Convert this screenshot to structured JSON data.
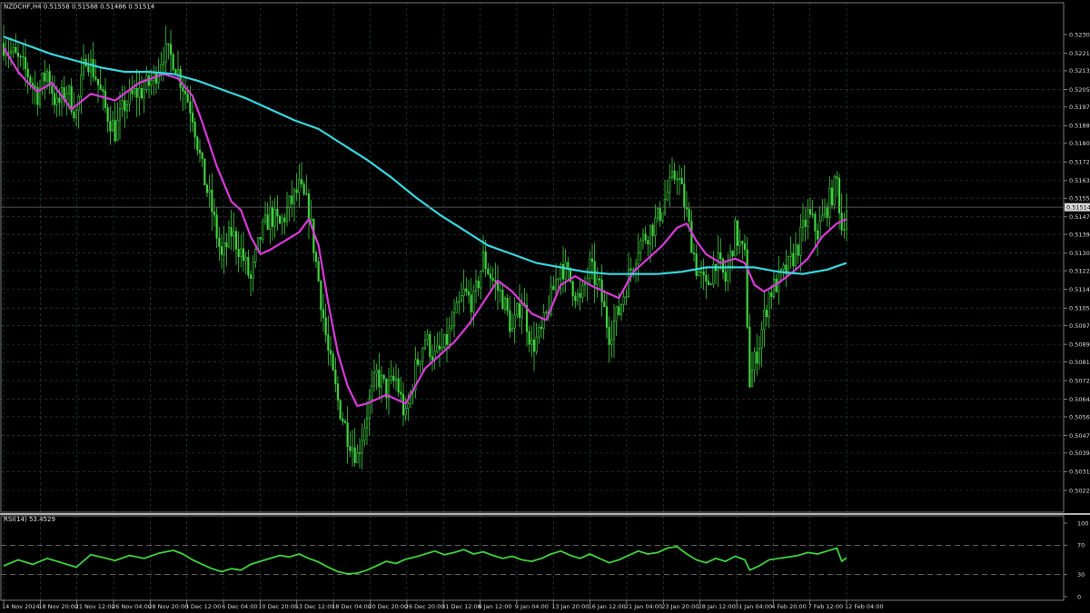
{
  "window": {
    "symbol_header": "NZDCHF,H4  0.51558 0.51588 0.51486 0.51514",
    "current_price_label": "0.51514",
    "indicator_header": "RSI(14) 53.4529"
  },
  "colors": {
    "background": "#000000",
    "grid": "#2f4a4a",
    "candle": "#3fd13f",
    "ma_fast": "#d83ad8",
    "ma_slow": "#38d8e0",
    "rsi_line": "#3fd13f",
    "text": "#d8d8d8"
  },
  "chart_data": [
    {
      "type": "candlestick",
      "title": "",
      "price_ticks": [
        "0.52300",
        "0.52215",
        "0.52135",
        "0.52050",
        "0.51970",
        "0.51885",
        "0.51805",
        "0.51720",
        "0.51635",
        "0.51555",
        "0.51470",
        "0.51390",
        "0.51305",
        "0.51225",
        "0.51140",
        "0.51055",
        "0.50975",
        "0.50890",
        "0.50810",
        "0.50725",
        "0.50640",
        "0.50560",
        "0.50475",
        "0.50395",
        "0.50310",
        "0.50225"
      ],
      "price_ylim": [
        0.50225,
        0.5236
      ],
      "current_price": 0.51514,
      "time_ticks": [
        "14 Nov 2024",
        "18 Nov 20:00",
        "21 Nov 12:00",
        "26 Nov 04:00",
        "28 Nov 20:00",
        "3 Dec 12:00",
        "6 Dec 04:00",
        "10 Dec 20:00",
        "13 Dec 12:00",
        "18 Dec 04:00",
        "20 Dec 20:00",
        "26 Dec 20:00",
        "31 Dec 12:00",
        "6 Jan 12:00",
        "9 Jan 04:00",
        "13 Jan 20:00",
        "16 Jan 12:00",
        "21 Jan 04:00",
        "23 Jan 20:00",
        "28 Jan 12:00",
        "31 Jan 04:00",
        "4 Feb 20:00",
        "7 Feb 12:00",
        "12 Feb 04:00"
      ],
      "grid": true,
      "close_anchors": [
        [
          0,
          0.5226
        ],
        [
          6,
          0.5218
        ],
        [
          10,
          0.5212
        ],
        [
          14,
          0.5203
        ],
        [
          18,
          0.5213
        ],
        [
          22,
          0.5197
        ],
        [
          26,
          0.5205
        ],
        [
          30,
          0.5194
        ],
        [
          34,
          0.5221
        ],
        [
          38,
          0.5211
        ],
        [
          42,
          0.5196
        ],
        [
          46,
          0.5186
        ],
        [
          50,
          0.5198
        ],
        [
          54,
          0.5203
        ],
        [
          58,
          0.5205
        ],
        [
          62,
          0.521
        ],
        [
          66,
          0.5222
        ],
        [
          70,
          0.5219
        ],
        [
          74,
          0.5207
        ],
        [
          78,
          0.5194
        ],
        [
          82,
          0.5168
        ],
        [
          86,
          0.515
        ],
        [
          90,
          0.5128
        ],
        [
          94,
          0.514
        ],
        [
          98,
          0.5131
        ],
        [
          102,
          0.5118
        ],
        [
          106,
          0.5138
        ],
        [
          110,
          0.5148
        ],
        [
          114,
          0.5143
        ],
        [
          118,
          0.5152
        ],
        [
          122,
          0.516
        ],
        [
          126,
          0.515
        ],
        [
          130,
          0.5118
        ],
        [
          134,
          0.5085
        ],
        [
          138,
          0.5063
        ],
        [
          142,
          0.5048
        ],
        [
          146,
          0.5038
        ],
        [
          150,
          0.5058
        ],
        [
          154,
          0.5075
        ],
        [
          158,
          0.5068
        ],
        [
          162,
          0.5073
        ],
        [
          166,
          0.5055
        ],
        [
          170,
          0.5078
        ],
        [
          174,
          0.5092
        ],
        [
          178,
          0.5083
        ],
        [
          182,
          0.5088
        ],
        [
          186,
          0.51
        ],
        [
          190,
          0.5112
        ],
        [
          194,
          0.5108
        ],
        [
          198,
          0.5128
        ],
        [
          202,
          0.5118
        ],
        [
          206,
          0.511
        ],
        [
          210,
          0.5095
        ],
        [
          214,
          0.511
        ],
        [
          218,
          0.5088
        ],
        [
          222,
          0.5094
        ],
        [
          226,
          0.511
        ],
        [
          230,
          0.5126
        ],
        [
          234,
          0.5118
        ],
        [
          238,
          0.5108
        ],
        [
          242,
          0.5124
        ],
        [
          246,
          0.5114
        ],
        [
          250,
          0.5094
        ],
        [
          254,
          0.5104
        ],
        [
          258,
          0.512
        ],
        [
          262,
          0.5134
        ],
        [
          266,
          0.514
        ],
        [
          270,
          0.5146
        ],
        [
          274,
          0.5158
        ],
        [
          278,
          0.5168
        ],
        [
          282,
          0.5148
        ],
        [
          286,
          0.5124
        ],
        [
          290,
          0.5114
        ],
        [
          294,
          0.5128
        ],
        [
          298,
          0.5118
        ],
        [
          302,
          0.514
        ],
        [
          306,
          0.5128
        ],
        [
          308,
          0.5072
        ],
        [
          312,
          0.509
        ],
        [
          316,
          0.5112
        ],
        [
          320,
          0.5118
        ],
        [
          324,
          0.5124
        ],
        [
          328,
          0.5134
        ],
        [
          332,
          0.5148
        ],
        [
          336,
          0.514
        ],
        [
          340,
          0.5152
        ],
        [
          344,
          0.5163
        ],
        [
          346,
          0.5142
        ],
        [
          348,
          0.5151
        ]
      ],
      "series": [
        {
          "name": "",
          "kind": "moving-average-fast",
          "color": "#d83ad8",
          "points": [
            [
              0,
              0.5224
            ],
            [
              6,
              0.5213
            ],
            [
              10,
              0.5208
            ],
            [
              14,
              0.5204
            ],
            [
              20,
              0.5208
            ],
            [
              28,
              0.5196
            ],
            [
              36,
              0.5203
            ],
            [
              46,
              0.52
            ],
            [
              56,
              0.5208
            ],
            [
              66,
              0.5212
            ],
            [
              72,
              0.521
            ],
            [
              78,
              0.5202
            ],
            [
              82,
              0.519
            ],
            [
              88,
              0.517
            ],
            [
              94,
              0.5154
            ],
            [
              98,
              0.515
            ],
            [
              102,
              0.5138
            ],
            [
              106,
              0.513
            ],
            [
              110,
              0.5132
            ],
            [
              116,
              0.5136
            ],
            [
              122,
              0.514
            ],
            [
              126,
              0.5146
            ],
            [
              130,
              0.5134
            ],
            [
              134,
              0.5108
            ],
            [
              138,
              0.5085
            ],
            [
              142,
              0.507
            ],
            [
              146,
              0.5061
            ],
            [
              150,
              0.5062
            ],
            [
              154,
              0.5064
            ],
            [
              158,
              0.5066
            ],
            [
              162,
              0.5064
            ],
            [
              166,
              0.5062
            ],
            [
              170,
              0.507
            ],
            [
              174,
              0.5078
            ],
            [
              180,
              0.5084
            ],
            [
              186,
              0.509
            ],
            [
              192,
              0.5098
            ],
            [
              198,
              0.5108
            ],
            [
              204,
              0.5118
            ],
            [
              210,
              0.5113
            ],
            [
              218,
              0.5103
            ],
            [
              224,
              0.51
            ],
            [
              230,
              0.5116
            ],
            [
              236,
              0.512
            ],
            [
              242,
              0.5116
            ],
            [
              248,
              0.5113
            ],
            [
              254,
              0.511
            ],
            [
              260,
              0.5122
            ],
            [
              266,
              0.5128
            ],
            [
              272,
              0.5134
            ],
            [
              278,
              0.5142
            ],
            [
              282,
              0.5144
            ],
            [
              286,
              0.5136
            ],
            [
              290,
              0.513
            ],
            [
              296,
              0.5126
            ],
            [
              302,
              0.5128
            ],
            [
              306,
              0.5126
            ],
            [
              310,
              0.5116
            ],
            [
              314,
              0.5113
            ],
            [
              320,
              0.5117
            ],
            [
              326,
              0.5122
            ],
            [
              332,
              0.5128
            ],
            [
              338,
              0.5138
            ],
            [
              344,
              0.5144
            ],
            [
              348,
              0.5146
            ]
          ]
        },
        {
          "name": "",
          "kind": "moving-average-slow",
          "color": "#38d8e0",
          "points": [
            [
              0,
              0.5229
            ],
            [
              10,
              0.5225
            ],
            [
              20,
              0.5221
            ],
            [
              30,
              0.5218
            ],
            [
              40,
              0.5215
            ],
            [
              50,
              0.5213
            ],
            [
              60,
              0.5213
            ],
            [
              70,
              0.5212
            ],
            [
              80,
              0.5209
            ],
            [
              90,
              0.5205
            ],
            [
              100,
              0.5201
            ],
            [
              110,
              0.5196
            ],
            [
              120,
              0.5191
            ],
            [
              130,
              0.5187
            ],
            [
              140,
              0.518
            ],
            [
              150,
              0.5173
            ],
            [
              160,
              0.5165
            ],
            [
              170,
              0.5156
            ],
            [
              180,
              0.5148
            ],
            [
              190,
              0.5141
            ],
            [
              200,
              0.5134
            ],
            [
              210,
              0.513
            ],
            [
              220,
              0.5126
            ],
            [
              230,
              0.5124
            ],
            [
              240,
              0.5122
            ],
            [
              250,
              0.5121
            ],
            [
              260,
              0.5121
            ],
            [
              270,
              0.5121
            ],
            [
              280,
              0.5122
            ],
            [
              290,
              0.5124
            ],
            [
              300,
              0.5124
            ],
            [
              310,
              0.5124
            ],
            [
              320,
              0.5122
            ],
            [
              330,
              0.5121
            ],
            [
              340,
              0.5123
            ],
            [
              348,
              0.5126
            ]
          ]
        }
      ]
    },
    {
      "type": "line",
      "title": "",
      "ylim": [
        0,
        100
      ],
      "y_ticks": [
        "100",
        "70",
        "30",
        "0"
      ],
      "levels": [
        70,
        30
      ],
      "current_value": 53.4529,
      "series": [
        {
          "name": "",
          "color": "#3fd13f",
          "points": [
            [
              0,
              42
            ],
            [
              6,
              50
            ],
            [
              12,
              44
            ],
            [
              18,
              52
            ],
            [
              24,
              46
            ],
            [
              30,
              40
            ],
            [
              36,
              57
            ],
            [
              40,
              54
            ],
            [
              46,
              49
            ],
            [
              52,
              56
            ],
            [
              58,
              52
            ],
            [
              64,
              59
            ],
            [
              70,
              63
            ],
            [
              74,
              58
            ],
            [
              78,
              50
            ],
            [
              82,
              44
            ],
            [
              86,
              38
            ],
            [
              90,
              34
            ],
            [
              94,
              38
            ],
            [
              98,
              36
            ],
            [
              102,
              44
            ],
            [
              106,
              48
            ],
            [
              110,
              52
            ],
            [
              114,
              56
            ],
            [
              118,
              54
            ],
            [
              122,
              58
            ],
            [
              126,
              52
            ],
            [
              130,
              47
            ],
            [
              134,
              40
            ],
            [
              138,
              34
            ],
            [
              142,
              31
            ],
            [
              146,
              32
            ],
            [
              150,
              36
            ],
            [
              154,
              42
            ],
            [
              158,
              48
            ],
            [
              162,
              45
            ],
            [
              166,
              51
            ],
            [
              170,
              54
            ],
            [
              174,
              58
            ],
            [
              178,
              62
            ],
            [
              182,
              57
            ],
            [
              186,
              60
            ],
            [
              190,
              64
            ],
            [
              194,
              58
            ],
            [
              198,
              61
            ],
            [
              202,
              56
            ],
            [
              206,
              52
            ],
            [
              210,
              55
            ],
            [
              214,
              50
            ],
            [
              218,
              48
            ],
            [
              222,
              52
            ],
            [
              226,
              58
            ],
            [
              230,
              62
            ],
            [
              234,
              56
            ],
            [
              238,
              52
            ],
            [
              242,
              58
            ],
            [
              246,
              52
            ],
            [
              250,
              46
            ],
            [
              254,
              50
            ],
            [
              258,
              56
            ],
            [
              262,
              62
            ],
            [
              266,
              58
            ],
            [
              270,
              60
            ],
            [
              274,
              66
            ],
            [
              278,
              68
            ],
            [
              282,
              58
            ],
            [
              286,
              50
            ],
            [
              290,
              46
            ],
            [
              294,
              52
            ],
            [
              298,
              48
            ],
            [
              302,
              55
            ],
            [
              306,
              50
            ],
            [
              308,
              36
            ],
            [
              312,
              42
            ],
            [
              316,
              50
            ],
            [
              320,
              52
            ],
            [
              324,
              54
            ],
            [
              328,
              56
            ],
            [
              332,
              60
            ],
            [
              336,
              58
            ],
            [
              340,
              62
            ],
            [
              344,
              66
            ],
            [
              346,
              48
            ],
            [
              348,
              53
            ]
          ]
        }
      ]
    }
  ]
}
